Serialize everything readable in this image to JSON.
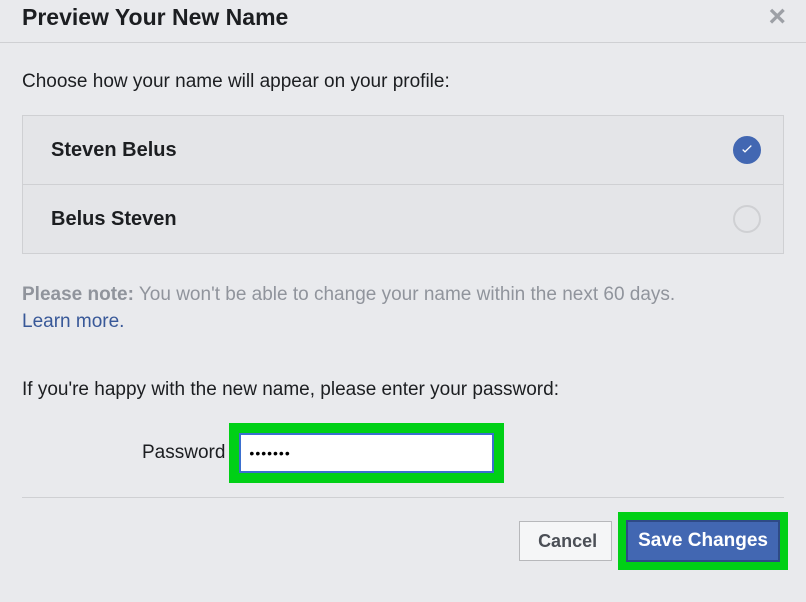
{
  "header": {
    "title": "Preview Your New Name"
  },
  "intro": "Choose how your name will appear on your profile:",
  "options": [
    {
      "name": "Steven Belus",
      "selected": true
    },
    {
      "name": "Belus Steven",
      "selected": false
    }
  ],
  "note": {
    "label": "Please note:",
    "text": " You won't be able to change your name within the next 60 days. ",
    "learn_more": "Learn more"
  },
  "confirm_text": "If you're happy with the new name, please enter your password:",
  "password": {
    "label": "Password",
    "value": "•••••••"
  },
  "footer": {
    "cancel": "Cancel",
    "save": "Save Changes"
  }
}
